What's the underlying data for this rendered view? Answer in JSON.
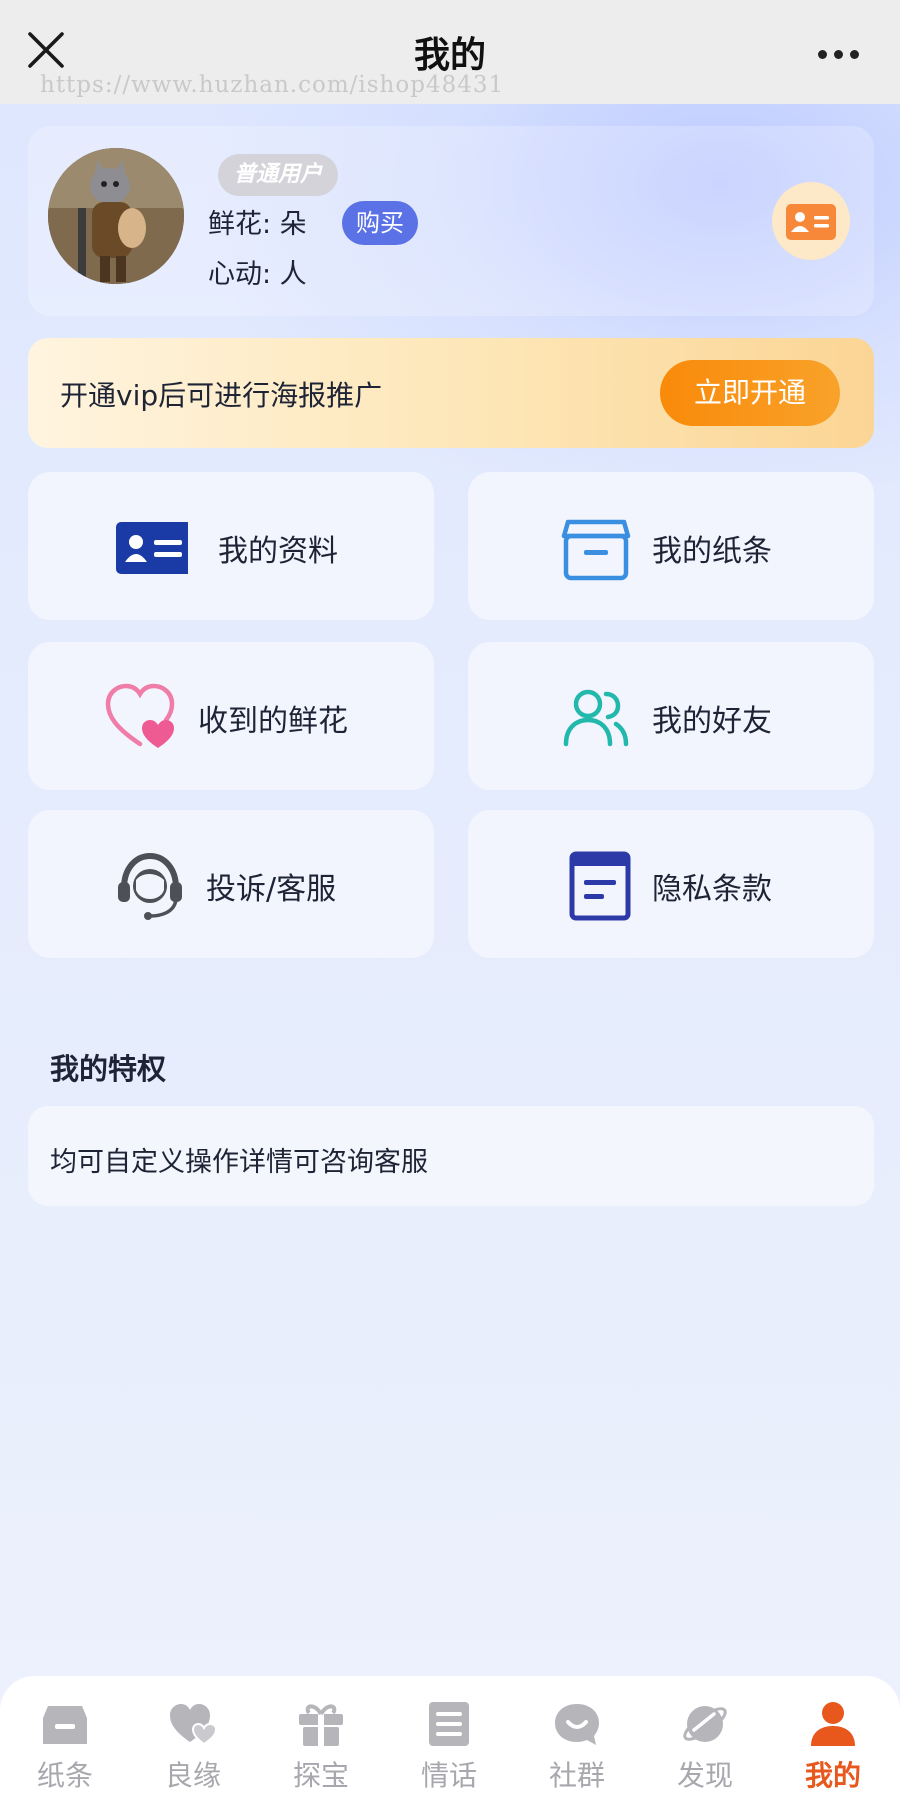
{
  "titlebar": {
    "title": "我的",
    "watermark": "https://www.huzhan.com/ishop48431"
  },
  "profile": {
    "badge": "普通用户",
    "flowers": "鲜花: 朵",
    "buy": "购买",
    "hearts": "心动: 人"
  },
  "vip": {
    "text": "开通vip后可进行海报推广",
    "button": "立即开通"
  },
  "menu": [
    {
      "label": "我的资料",
      "icon": "id-card-icon"
    },
    {
      "label": "我的纸条",
      "icon": "box-icon"
    },
    {
      "label": "收到的鲜花",
      "icon": "heart-icon"
    },
    {
      "label": "我的好友",
      "icon": "friends-icon"
    },
    {
      "label": "投诉/客服",
      "icon": "headset-icon"
    },
    {
      "label": "隐私条款",
      "icon": "document-icon"
    }
  ],
  "privileges": {
    "title": "我的特权",
    "text": "均可自定义操作详情可咨询客服"
  },
  "nav": [
    {
      "label": "纸条",
      "icon": "note-icon",
      "active": false
    },
    {
      "label": "良缘",
      "icon": "hearts-icon",
      "active": false
    },
    {
      "label": "探宝",
      "icon": "gift-icon",
      "active": false
    },
    {
      "label": "情话",
      "icon": "list-icon",
      "active": false
    },
    {
      "label": "社群",
      "icon": "chat-icon",
      "active": false
    },
    {
      "label": "发现",
      "icon": "planet-icon",
      "active": false
    },
    {
      "label": "我的",
      "icon": "person-icon",
      "active": true
    }
  ],
  "colors": {
    "accent_blue": "#5a72e6",
    "vip_orange": "#f98a0a",
    "nav_active": "#e8571b",
    "nav_inactive": "#a7a7ad"
  }
}
